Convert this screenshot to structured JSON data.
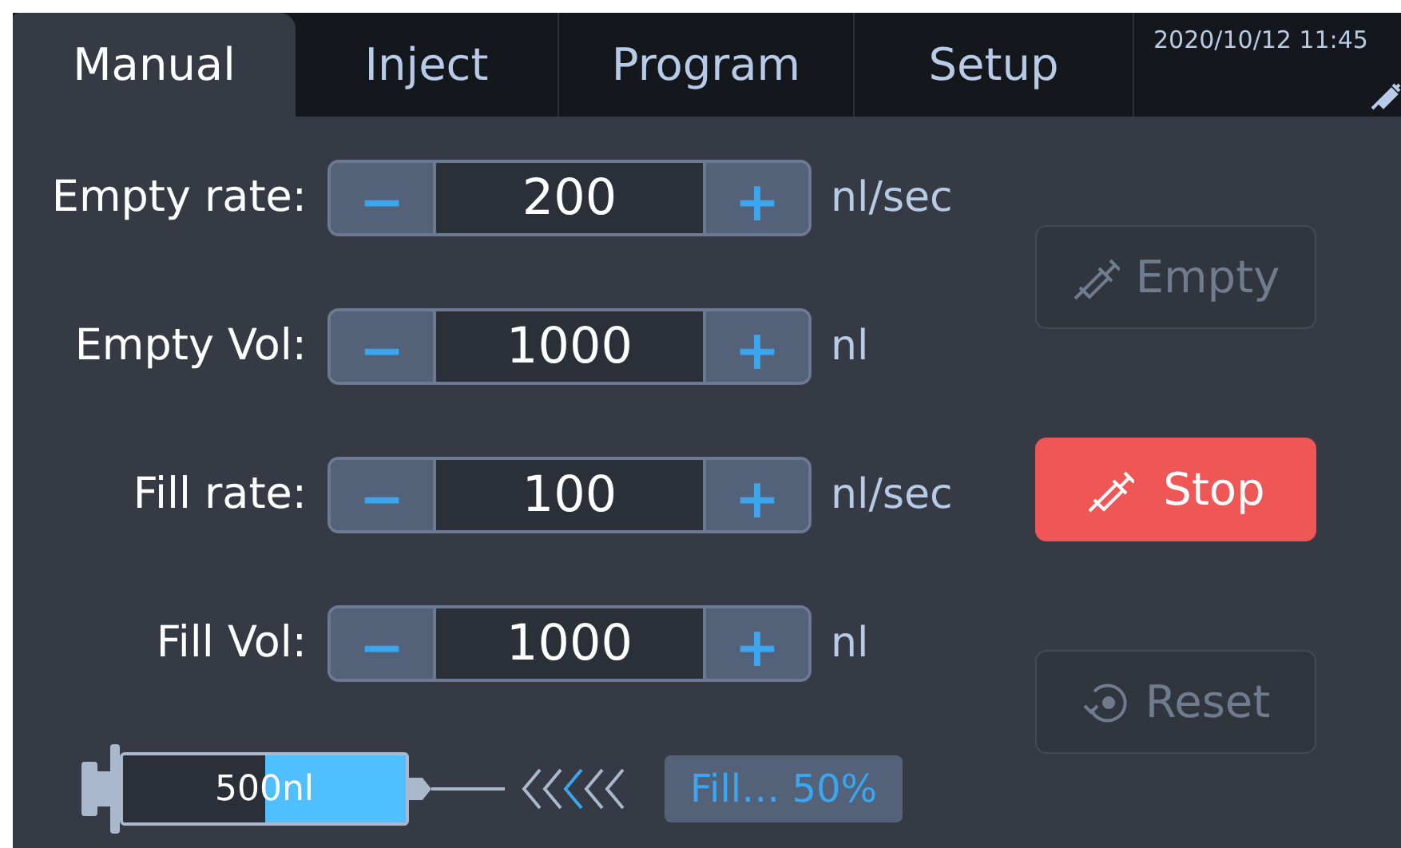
{
  "tabs": [
    {
      "label": "Manual",
      "selected": true
    },
    {
      "label": "Inject",
      "selected": false
    },
    {
      "label": "Program",
      "selected": false
    },
    {
      "label": "Setup",
      "selected": false
    }
  ],
  "datetime": "2020/10/12 11:45",
  "settings": [
    {
      "label": "Empty rate:",
      "decrement": "−",
      "value": "200",
      "increment": "+",
      "unit": "nl/sec"
    },
    {
      "label": "Empty Vol:",
      "decrement": "−",
      "value": "1000",
      "increment": "+",
      "unit": "nl"
    },
    {
      "label": "Fill rate:",
      "decrement": "−",
      "value": "100",
      "increment": "+",
      "unit": "nl/sec"
    },
    {
      "label": "Fill Vol:",
      "decrement": "−",
      "value": "1000",
      "increment": "+",
      "unit": "nl"
    }
  ],
  "actions": [
    {
      "label": "Empty",
      "kind": "syringe",
      "disabled": true,
      "danger": false
    },
    {
      "label": "Stop",
      "kind": "syringe",
      "disabled": false,
      "danger": true
    },
    {
      "label": "Reset",
      "kind": "reset",
      "disabled": true,
      "danger": false
    }
  ],
  "syringe": {
    "volume": "500nl",
    "level": 0.5
  },
  "status": "Fill… 50%"
}
